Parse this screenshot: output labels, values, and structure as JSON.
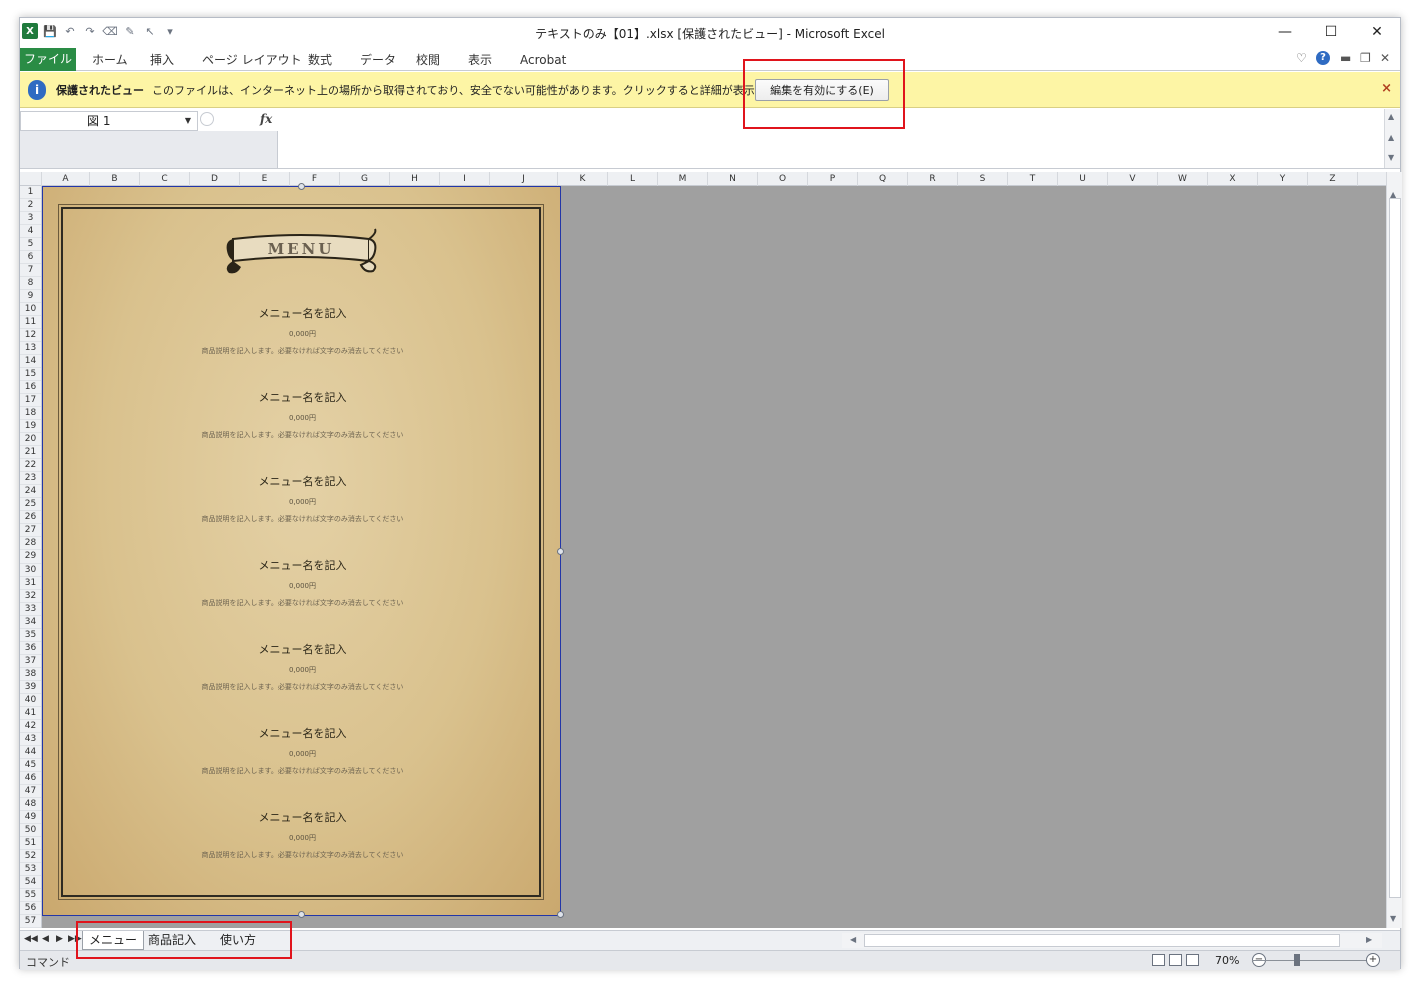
{
  "window": {
    "title": "テキストのみ【01】.xlsx  [保護されたビュー] - Microsoft Excel",
    "minimize": "—",
    "maximize": "☐",
    "close": "✕"
  },
  "ribbon": {
    "tabs": [
      "ファイル",
      "ホーム",
      "挿入",
      "ページ レイアウト",
      "数式",
      "データ",
      "校閲",
      "表示",
      "Acrobat"
    ]
  },
  "protected_bar": {
    "title": "保護されたビュー",
    "message": "このファイルは、インターネット上の場所から取得されており、安全でない可能性があります。クリックすると詳細が表示されます。",
    "enable_button": "編集を有効にする(E)",
    "close": "×"
  },
  "formula_bar": {
    "name_box": "図 1",
    "fx": "fx",
    "value": ""
  },
  "columns": [
    "A",
    "B",
    "C",
    "D",
    "E",
    "F",
    "G",
    "H",
    "I",
    "J",
    "K",
    "L",
    "M",
    "N",
    "O",
    "P",
    "Q",
    "R",
    "S",
    "T",
    "U",
    "V",
    "W",
    "X",
    "Y",
    "Z"
  ],
  "rows_count": 57,
  "menu_card": {
    "banner": "MENU",
    "items": [
      {
        "name": "メニュー名を記入",
        "price": "0,000円",
        "desc": "商品説明を記入します。必要なければ文字のみ消去してください"
      },
      {
        "name": "メニュー名を記入",
        "price": "0,000円",
        "desc": "商品説明を記入します。必要なければ文字のみ消去してください"
      },
      {
        "name": "メニュー名を記入",
        "price": "0,000円",
        "desc": "商品説明を記入します。必要なければ文字のみ消去してください"
      },
      {
        "name": "メニュー名を記入",
        "price": "0,000円",
        "desc": "商品説明を記入します。必要なければ文字のみ消去してください"
      },
      {
        "name": "メニュー名を記入",
        "price": "0,000円",
        "desc": "商品説明を記入します。必要なければ文字のみ消去してください"
      },
      {
        "name": "メニュー名を記入",
        "price": "0,000円",
        "desc": "商品説明を記入します。必要なければ文字のみ消去してください"
      },
      {
        "name": "メニュー名を記入",
        "price": "0,000円",
        "desc": "商品説明を記入します。必要なければ文字のみ消去してください"
      }
    ]
  },
  "sheet_tabs": [
    "メニュー",
    "商品記入",
    "使い方"
  ],
  "status": {
    "mode": "コマンド",
    "zoom": "70%"
  },
  "colors": {
    "file_tab": "#2a8c45",
    "protected_bar": "#fdf5a5",
    "highlight": "#e0141c"
  }
}
